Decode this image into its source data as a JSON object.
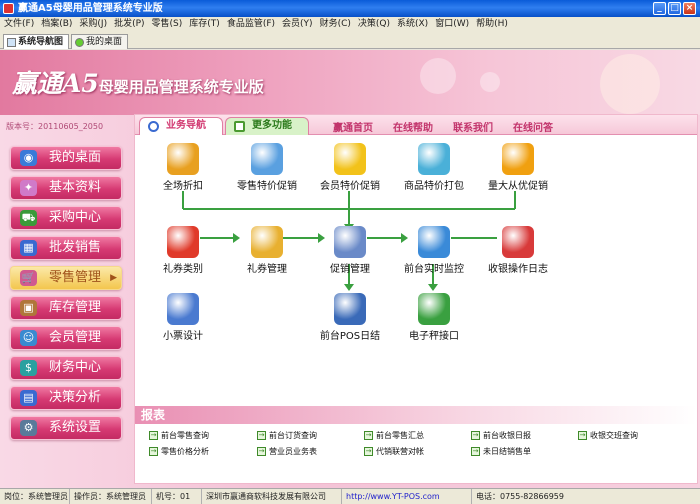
{
  "window": {
    "title": "赢通A5母婴用品管理系统专业版"
  },
  "menu": [
    "文件(F)",
    "档案(B)",
    "采购(J)",
    "批发(P)",
    "零售(S)",
    "库存(T)",
    "食品监管(F)",
    "会员(Y)",
    "财务(C)",
    "决策(Q)",
    "系统(X)",
    "窗口(W)",
    "帮助(H)"
  ],
  "tabs": [
    {
      "label": "系统导航图"
    },
    {
      "label": "我的桌面"
    }
  ],
  "banner": {
    "logo_main": "赢通A5",
    "logo_sub": "母婴用品管理系统专业版",
    "version": "版本号：20110605_2050"
  },
  "sidebar": [
    {
      "label": "我的桌面",
      "icon": "desktop-icon",
      "color": "#3a7ad8"
    },
    {
      "label": "基本资料",
      "icon": "profile-icon",
      "color": "#d07ac8"
    },
    {
      "label": "采购中心",
      "icon": "truck-icon",
      "color": "#3a9a3a"
    },
    {
      "label": "批发销售",
      "icon": "box-icon",
      "color": "#3a6ad0"
    },
    {
      "label": "零售管理",
      "icon": "cart-icon",
      "color": "#d05a90",
      "active": true
    },
    {
      "label": "库存管理",
      "icon": "warehouse-icon",
      "color": "#b0763a"
    },
    {
      "label": "会员管理",
      "icon": "members-icon",
      "color": "#3a8ad0"
    },
    {
      "label": "财务中心",
      "icon": "finance-icon",
      "color": "#2aa0a0"
    },
    {
      "label": "决策分析",
      "icon": "chart-icon",
      "color": "#3a6ad0"
    },
    {
      "label": "系统设置",
      "icon": "settings-icon",
      "color": "#5a7a9a"
    }
  ],
  "panel": {
    "tab_business": "业务导航",
    "tab_more": "更多功能",
    "links": [
      "赢通首页",
      "在线帮助",
      "联系我们",
      "在线问答"
    ],
    "features": [
      {
        "label": "全场折扣",
        "icon": "coins-icon",
        "color": "#e8a020"
      },
      {
        "label": "零售特价促销",
        "icon": "price-tag-icon",
        "color": "#5aa0e0"
      },
      {
        "label": "会员特价促销",
        "icon": "member-smile-icon",
        "color": "#f2c21a"
      },
      {
        "label": "商品特价打包",
        "icon": "basket-icon",
        "color": "#4ab0d8"
      },
      {
        "label": "量大从优促销",
        "icon": "sale-badge-icon",
        "color": "#f0a010"
      },
      {
        "label": "礼券类别",
        "icon": "gift-icon",
        "color": "#e03a2a"
      },
      {
        "label": "礼券管理",
        "icon": "voucher-icon",
        "color": "#e8b030"
      },
      {
        "label": "促销管理",
        "icon": "promo-icon",
        "color": "#6a8ac8"
      },
      {
        "label": "前台实时监控",
        "icon": "clock-icon",
        "color": "#3a8ad8"
      },
      {
        "label": "收银操作日志",
        "icon": "card-icon",
        "color": "#d83a3a"
      },
      {
        "label": "小票设计",
        "icon": "receipt-icon",
        "color": "#4a7ad0"
      },
      {
        "label": "前台POS日结",
        "icon": "pos-icon",
        "color": "#3a6ab8"
      },
      {
        "label": "电子秤接口",
        "icon": "scale-folder-icon",
        "color": "#3aa040"
      }
    ],
    "reports_title": "报表",
    "reports": [
      "前台零售查询",
      "前台订货查询",
      "前台零售汇总",
      "前台收银日报",
      "收银交班查询",
      "零售价格分析",
      "营业员业务表",
      "代销联营对帐",
      "未日结销售单"
    ]
  },
  "status": {
    "post": "岗位：系统管理员",
    "operator": "操作员：系统管理员",
    "machine": "机号：01",
    "company": "深圳市赢通商软科技发展有限公司",
    "website": "http://www.YT-POS.com",
    "phone": "电话：0755-82866959"
  }
}
